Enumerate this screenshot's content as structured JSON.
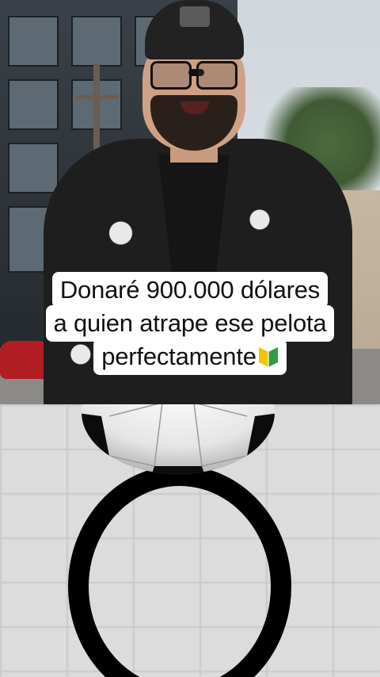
{
  "caption": {
    "line1": "Donaré 900.000 dólares",
    "line2": "a quien atrape ese pelota",
    "line3": "perfectamente",
    "emoji": "beginner-symbol"
  },
  "video": {
    "subject": "man-talking-outdoors"
  },
  "game": {
    "ball_icon": "soccer-ball-icon",
    "target_icon": "ring-target-icon"
  }
}
